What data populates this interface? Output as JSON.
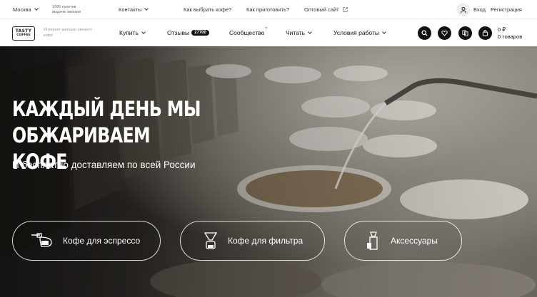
{
  "topbar": {
    "city": "Москва",
    "points_line1": "1995 пунктов",
    "points_line2": "выдачи заказов",
    "contacts": "Контакты",
    "how_choose": "Как выбрать кофе?",
    "how_cook": "Как приготовить?",
    "wholesale": "Оптовый сайт",
    "login": "Вход",
    "register": "Регистрация"
  },
  "nav": {
    "logo_line1": "TASTY",
    "logo_line2": "COFFEE",
    "tagline": "Интернет-магазин свежего кофе",
    "buy": "Купить",
    "reviews": "Отзывы",
    "reviews_count": "27700",
    "community": "Сообщество",
    "community_sup": "?",
    "read": "Читать",
    "terms": "Условия работы",
    "cart_sum": "0 ₽",
    "cart_items": "0 товаров"
  },
  "hero": {
    "title": "КАЖДЫЙ ДЕНЬ МЫ ОБЖАРИВАЕМ КОФЕ",
    "subtitle": "И бесплатно доставляем по всей России",
    "categories": [
      {
        "label": "Кофе для эспрессо",
        "icon": "espresso-machine-icon"
      },
      {
        "label": "Кофе для фильтра",
        "icon": "pour-over-icon"
      },
      {
        "label": "Аксессуары",
        "icon": "grinder-icon"
      }
    ]
  },
  "colors": {
    "dark": "#111111",
    "white": "#ffffff",
    "muted": "#999999"
  }
}
